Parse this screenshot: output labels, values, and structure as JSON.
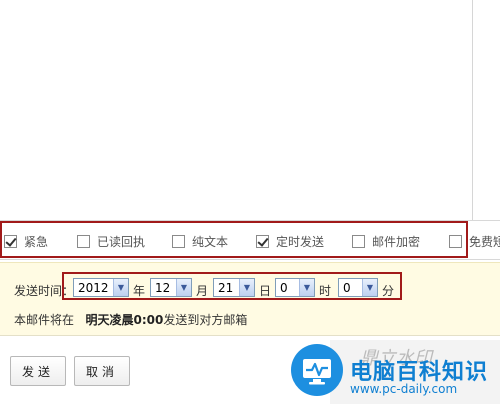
{
  "options": {
    "urgent": {
      "label": "紧急",
      "checked": true
    },
    "read_receipt": {
      "label": "已读回执",
      "checked": false
    },
    "plain_text": {
      "label": "纯文本",
      "checked": false
    },
    "scheduled_send": {
      "label": "定时发送",
      "checked": true
    },
    "encrypt": {
      "label": "邮件加密",
      "checked": false
    },
    "free_sms": {
      "label": "免费短",
      "checked": false
    }
  },
  "schedule": {
    "label": "发送时间：",
    "year": {
      "value": "2012",
      "unit": "年"
    },
    "month": {
      "value": "12",
      "unit": "月"
    },
    "day": {
      "value": "21",
      "unit": "日"
    },
    "hour": {
      "value": "0",
      "unit": "时"
    },
    "minute": {
      "value": "0",
      "unit": "分"
    },
    "notice_prefix": "本邮件将在",
    "notice_time": "明天凌晨0:00",
    "notice_suffix": "发送到对方邮箱"
  },
  "buttons": {
    "send": "发送",
    "cancel": "取消"
  },
  "watermark": {
    "title": "电脑百科知识",
    "url": "www.pc-daily.com",
    "script": "鼎立水印"
  }
}
